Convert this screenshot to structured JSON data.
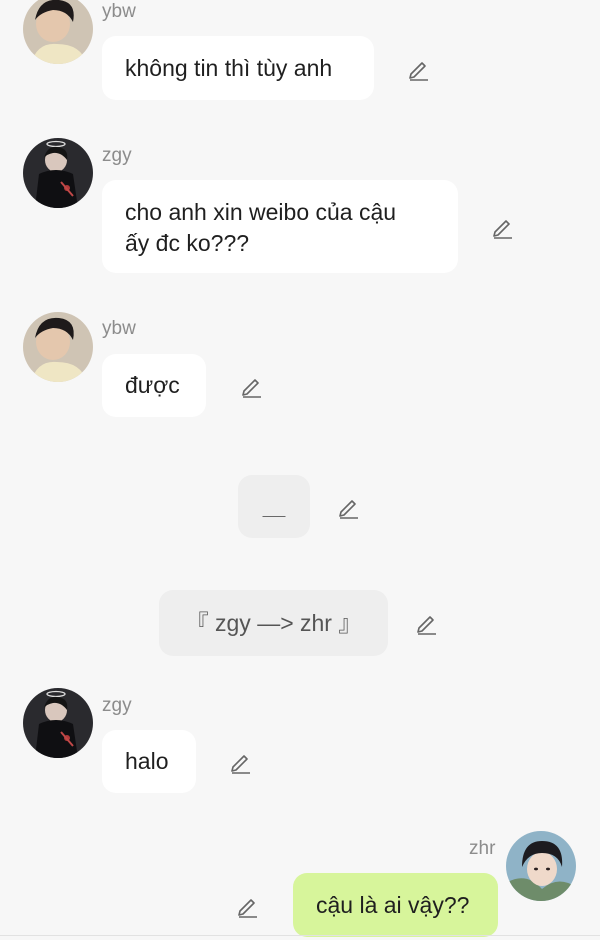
{
  "messages": [
    {
      "sender": "ybw",
      "text": "không tin thì tùy anh"
    },
    {
      "sender": "zgy",
      "line1": "cho anh xin weibo của cậu",
      "line2": "ấy đc ko???"
    },
    {
      "sender": "ybw",
      "text": "được"
    },
    {
      "type": "system",
      "text": "＿"
    },
    {
      "type": "system",
      "text": "『 zgy —> zhr 』"
    },
    {
      "sender": "zgy",
      "text": "halo"
    },
    {
      "sender": "zhr",
      "text": "cậu là ai vậy??",
      "outgoing": true
    }
  ],
  "icons": {
    "edit": "edit-pencil-icon",
    "avatar": "avatar-photo"
  },
  "colors": {
    "background": "#f7f7f7",
    "incoming_bubble": "#ffffff",
    "system_bubble": "#eeeeee",
    "outgoing_bubble": "#d7f59b",
    "sender_name": "#8c8c8c"
  }
}
